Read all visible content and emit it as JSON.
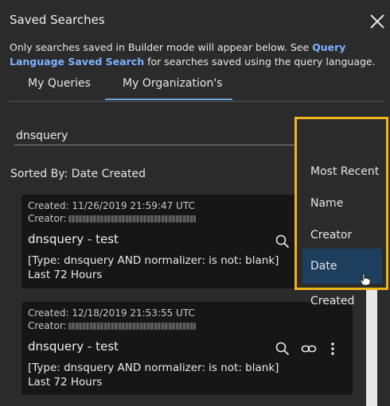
{
  "panel": {
    "title": "Saved Searches",
    "info_prefix": "Only searches saved in Builder mode will appear below. See ",
    "info_link": "Query Language Saved Search",
    "info_suffix": " for searches saved using the query language."
  },
  "tabs": [
    {
      "label": "My Queries",
      "active": false
    },
    {
      "label": "My Organization's",
      "active": true
    }
  ],
  "search": {
    "value": "dnsquery"
  },
  "sorted_by": "Sorted By: Date Created",
  "sort_menu": {
    "items": [
      "Most Recent",
      "Name",
      "Creator",
      "Date Created"
    ],
    "selected": "Date Created"
  },
  "cards": [
    {
      "created": "Created: 11/26/2019 21:59:47 UTC",
      "creator_label": "Creator:",
      "name": "dnsquery - test",
      "query": "[Type: dnsquery AND normalizer: is not: blank]",
      "range": "Last 72 Hours"
    },
    {
      "created": "Created: 12/18/2019 21:53:55 UTC",
      "creator_label": "Creator:",
      "name": "dnsquery - test",
      "query": "[Type: dnsquery AND normalizer: is not: blank]",
      "range": "Last 72 Hours"
    }
  ],
  "colors": {
    "accent": "#7db3ff",
    "highlight": "#f0b41c",
    "selected_bg": "#1e3e5e",
    "card_bg": "#161616"
  }
}
